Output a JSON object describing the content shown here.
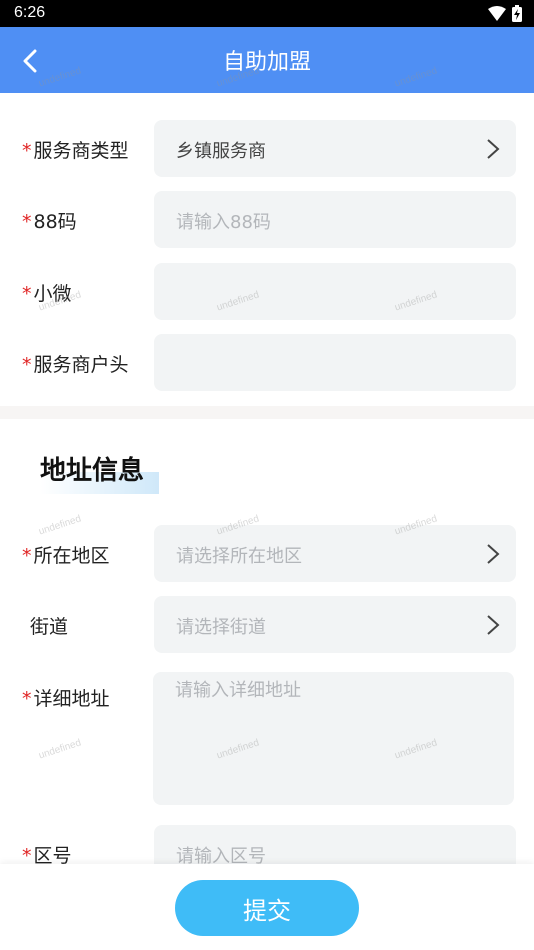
{
  "status_bar": {
    "time": "6:26",
    "icons": [
      "wifi-icon",
      "battery-charging-icon"
    ]
  },
  "header": {
    "title": "自助加盟",
    "back_icon": "chevron-left-icon",
    "background": "#4f8ff4"
  },
  "form": {
    "required_mark": "*",
    "fields": [
      {
        "label": "服务商类型",
        "required": true,
        "value": "乡镇服务商",
        "placeholder": "",
        "has_arrow": true
      },
      {
        "label": "88码",
        "required": true,
        "value": "",
        "placeholder": "请输入88码",
        "has_arrow": false
      },
      {
        "label": "小微",
        "required": true,
        "value": "",
        "placeholder": "",
        "has_arrow": false
      },
      {
        "label": "服务商户头",
        "required": true,
        "value": "",
        "placeholder": "",
        "has_arrow": false
      }
    ]
  },
  "address_section": {
    "title": "地址信息",
    "fields": [
      {
        "label": "所在地区",
        "required": true,
        "placeholder": "请选择所在地区",
        "has_arrow": true
      },
      {
        "label": "街道",
        "required": false,
        "placeholder": "请选择街道",
        "has_arrow": true
      },
      {
        "label": "详细地址",
        "required": true,
        "placeholder": "请输入详细地址",
        "type": "textarea"
      },
      {
        "label": "区号",
        "required": true,
        "placeholder": "请输入区号"
      }
    ]
  },
  "submit": {
    "label": "提交",
    "color": "#3fbcf7"
  },
  "watermark": "undefined"
}
